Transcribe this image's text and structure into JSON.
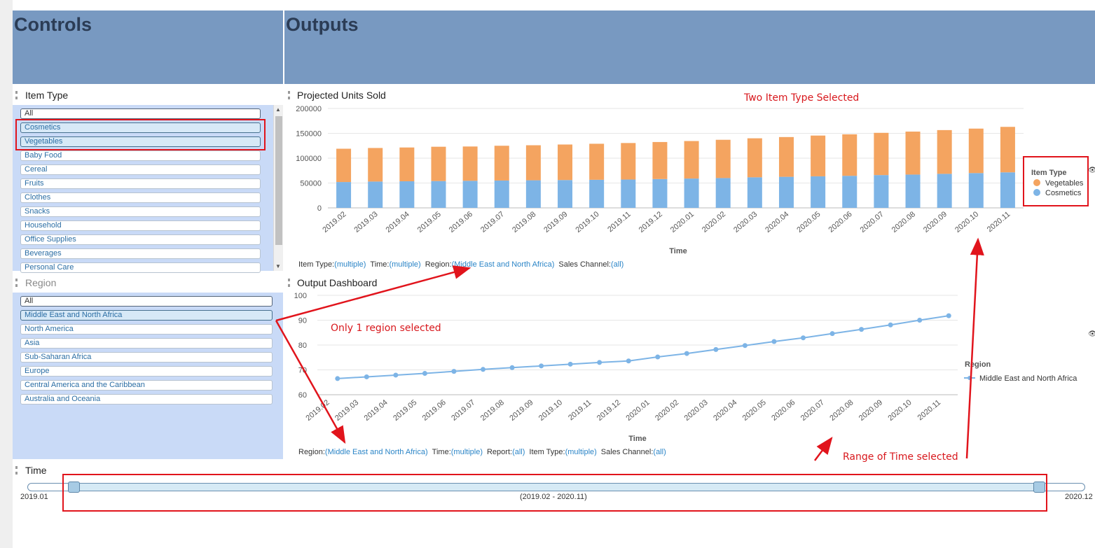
{
  "headers": {
    "controls": "Controls",
    "outputs": "Outputs"
  },
  "item_type": {
    "title": "Item Type",
    "items": [
      "All",
      "Cosmetics",
      "Vegetables",
      "Baby Food",
      "Cereal",
      "Fruits",
      "Clothes",
      "Snacks",
      "Household",
      "Office Supplies",
      "Beverages",
      "Personal Care"
    ],
    "selected": [
      "Cosmetics",
      "Vegetables"
    ]
  },
  "region": {
    "title": "Region",
    "items": [
      "All",
      "Middle East and North Africa",
      "North America",
      "Asia",
      "Sub-Saharan Africa",
      "Europe",
      "Central America and the Caribbean",
      "Australia and Oceania"
    ],
    "selected": [
      "Middle East and North Africa"
    ]
  },
  "projected_panel": {
    "title": "Projected Units Sold",
    "annotation": "Two Item Type Selected",
    "filters": [
      {
        "label": "Item Type:",
        "value": "(multiple)"
      },
      {
        "label": "Time:",
        "value": "(multiple)"
      },
      {
        "label": "Region:",
        "value": "(Middle East and North Africa)"
      },
      {
        "label": "Sales Channel:",
        "value": "(all)"
      }
    ]
  },
  "dashboard_panel": {
    "title": "Output Dashboard",
    "annotation": "Only 1 region selected",
    "filters": [
      {
        "label": "Region:",
        "value": "(Middle East and North Africa)"
      },
      {
        "label": "Time:",
        "value": "(multiple)"
      },
      {
        "label": "Report:",
        "value": "(all)"
      },
      {
        "label": "Item Type:",
        "value": "(multiple)"
      },
      {
        "label": "Sales Channel:",
        "value": "(all)"
      }
    ]
  },
  "time_panel": {
    "title": "Time",
    "min_label": "2019.01",
    "max_label": "2020.12",
    "range_label": "(2019.02 - 2020.11)",
    "annotation": "Range of Time selected"
  },
  "colors": {
    "vegetables": "#f4a460",
    "cosmetics": "#7db4e6",
    "header": "#7899c1",
    "annotation": "#e1141c"
  },
  "chart_data": [
    {
      "type": "bar",
      "stacked": true,
      "xlabel": "Time",
      "ylabel": "",
      "ylim": [
        0,
        200000
      ],
      "yticks": [
        0,
        50000,
        100000,
        150000,
        200000
      ],
      "legend_title": "Item Type",
      "legend_position": "right",
      "categories": [
        "2019.02",
        "2019.03",
        "2019.04",
        "2019.05",
        "2019.06",
        "2019.07",
        "2019.08",
        "2019.09",
        "2019.10",
        "2019.11",
        "2019.12",
        "2020.01",
        "2020.02",
        "2020.03",
        "2020.04",
        "2020.05",
        "2020.06",
        "2020.07",
        "2020.08",
        "2020.09",
        "2020.10",
        "2020.11"
      ],
      "series": [
        {
          "name": "Cosmetics",
          "values": [
            52000,
            53000,
            53500,
            54000,
            54500,
            55000,
            55500,
            56000,
            56500,
            57000,
            58000,
            59000,
            60000,
            61500,
            62500,
            63500,
            64500,
            66000,
            67000,
            68500,
            70000,
            71500
          ]
        },
        {
          "name": "Vegetables",
          "values": [
            67000,
            67500,
            68000,
            69000,
            69000,
            70000,
            70500,
            71500,
            72500,
            73500,
            74500,
            75500,
            77000,
            78500,
            80000,
            82000,
            83500,
            85000,
            86500,
            88000,
            89500,
            91500
          ]
        }
      ]
    },
    {
      "type": "line",
      "xlabel": "Time",
      "ylabel": "",
      "ylim": [
        60,
        100
      ],
      "yticks": [
        60,
        70,
        80,
        90,
        100
      ],
      "legend_title": "Region",
      "legend_position": "right",
      "categories": [
        "2019.02",
        "2019.03",
        "2019.04",
        "2019.05",
        "2019.06",
        "2019.07",
        "2019.08",
        "2019.09",
        "2019.10",
        "2019.11",
        "2019.12",
        "2020.01",
        "2020.02",
        "2020.03",
        "2020.04",
        "2020.05",
        "2020.06",
        "2020.07",
        "2020.08",
        "2020.09",
        "2020.10",
        "2020.11"
      ],
      "series": [
        {
          "name": "Middle East and North Africa",
          "values": [
            66.5,
            67.2,
            67.9,
            68.6,
            69.4,
            70.2,
            70.9,
            71.6,
            72.3,
            73,
            73.6,
            75.2,
            76.6,
            78.2,
            79.8,
            81.4,
            82.9,
            84.6,
            86.3,
            88.1,
            90,
            91.8
          ]
        }
      ]
    }
  ]
}
